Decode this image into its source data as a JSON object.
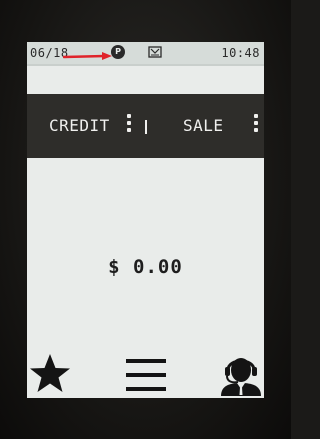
{
  "status_bar": {
    "date": "06/18",
    "time": "10:48",
    "indicator_letter": "P",
    "icons": [
      "p-indicator-icon",
      "tray-icon"
    ],
    "annotation_color": "#e0232a"
  },
  "menu": {
    "items": [
      {
        "label": "CREDIT"
      },
      {
        "label": "SALE"
      }
    ],
    "separator": "|"
  },
  "main": {
    "amount": "$ 0.00"
  },
  "bottom_bar": {
    "icons": [
      "star-icon",
      "hamburger-menu-icon",
      "support-agent-icon"
    ]
  },
  "colors": {
    "screen_background": "#e9ecea",
    "menu_background": "#2e2d2a",
    "menu_text": "#f0f0ee",
    "body_text": "#1e1e1e"
  }
}
